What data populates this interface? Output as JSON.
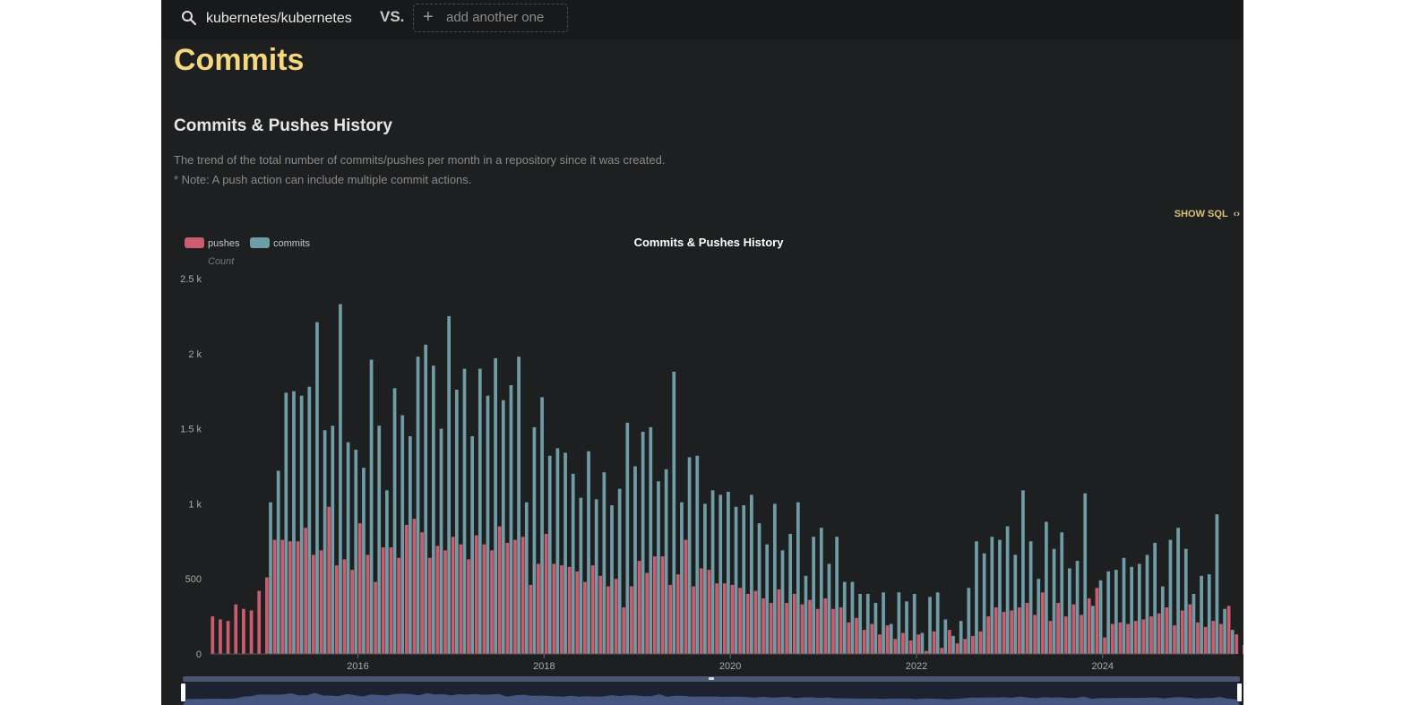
{
  "search": {
    "repo": "kubernetes/kubernetes",
    "vs_label": "VS.",
    "add_placeholder": "add another one"
  },
  "page_title": "Commits",
  "section": {
    "title": "Commits & Pushes History",
    "description": "The trend of the total number of commits/pushes per month in a repository since it was created.",
    "note": "* Note: A push action can include multiple commit actions."
  },
  "show_sql_label": "SHOW SQL",
  "colors": {
    "pushes": "#cc5c6e",
    "commits": "#6f9da6",
    "accent": "#f5d77e",
    "background": "#1e1f20"
  },
  "chart_data": {
    "type": "bar",
    "title": "Commits & Pushes History",
    "ylabel": "Count",
    "ylim": [
      0,
      2500
    ],
    "yticks": [
      0,
      500,
      1000,
      1500,
      2000,
      2500
    ],
    "ytick_labels": [
      "0",
      "500",
      "1 k",
      "1.5 k",
      "2 k",
      "2.5 k"
    ],
    "xtick_labels": [
      "2016",
      "2018",
      "2020",
      "2022",
      "2024"
    ],
    "x_start": "2014-06",
    "x_end": "2025-05",
    "legend": [
      "pushes",
      "commits"
    ],
    "legend_position": "top-left",
    "series": [
      {
        "name": "pushes",
        "values": [
          250,
          230,
          220,
          330,
          300,
          290,
          420,
          510,
          760,
          760,
          750,
          750,
          840,
          660,
          690,
          980,
          590,
          630,
          560,
          870,
          660,
          480,
          710,
          710,
          640,
          860,
          900,
          810,
          640,
          720,
          690,
          780,
          730,
          630,
          790,
          730,
          690,
          850,
          740,
          760,
          780,
          460,
          600,
          800,
          600,
          590,
          580,
          550,
          480,
          590,
          520,
          450,
          500,
          310,
          450,
          620,
          540,
          650,
          650,
          460,
          530,
          760,
          450,
          570,
          560,
          470,
          470,
          460,
          440,
          400,
          420,
          370,
          340,
          430,
          340,
          400,
          330,
          360,
          300,
          370,
          300,
          310,
          210,
          240,
          160,
          200,
          130,
          190,
          100,
          140,
          90,
          130,
          20,
          150,
          40,
          160,
          70,
          100,
          120,
          150,
          250,
          310,
          280,
          290,
          310,
          340,
          260,
          410,
          220,
          340,
          250,
          330,
          260,
          370,
          440,
          110,
          200,
          210,
          200,
          220,
          230,
          250,
          270,
          310,
          190,
          290,
          330,
          210,
          180,
          220,
          200,
          320,
          130,
          60
        ],
        "note": "one bar per month"
      },
      {
        "name": "commits",
        "values": [
          null,
          null,
          null,
          null,
          null,
          null,
          null,
          1010,
          1220,
          1740,
          1750,
          1720,
          1780,
          2210,
          1490,
          1520,
          2330,
          1410,
          1360,
          1240,
          1960,
          1520,
          1090,
          1770,
          1590,
          1450,
          1980,
          2060,
          1920,
          1500,
          2250,
          1760,
          1900,
          1450,
          1900,
          1720,
          1970,
          1690,
          1790,
          1980,
          1010,
          1510,
          1710,
          1320,
          1370,
          1340,
          1200,
          1040,
          1350,
          1030,
          1210,
          990,
          1100,
          1540,
          1250,
          1480,
          1510,
          1150,
          1230,
          1880,
          1010,
          1310,
          1320,
          1000,
          1090,
          1060,
          1080,
          980,
          990,
          1060,
          870,
          730,
          1000,
          690,
          800,
          1010,
          520,
          780,
          840,
          600,
          780,
          480,
          480,
          400,
          400,
          340,
          410,
          200,
          410,
          350,
          400,
          140,
          380,
          410,
          230,
          120,
          220,
          440,
          750,
          670,
          780,
          760,
          850,
          660,
          1090,
          750,
          500,
          880,
          700,
          810,
          570,
          620,
          1070,
          320,
          490,
          550,
          560,
          640,
          580,
          600,
          660,
          740,
          450,
          760,
          840,
          700,
          400,
          520,
          530,
          930,
          300,
          160
        ]
      }
    ]
  }
}
